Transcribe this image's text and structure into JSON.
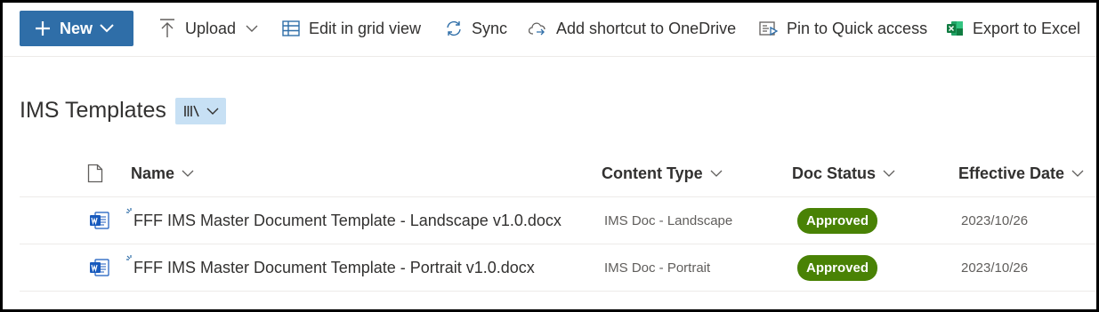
{
  "toolbar": {
    "new_label": "New",
    "upload_label": "Upload",
    "grid_label": "Edit in grid view",
    "sync_label": "Sync",
    "shortcut_label": "Add shortcut to OneDrive",
    "pin_label": "Pin to Quick access",
    "export_label": "Export to Excel"
  },
  "library": {
    "title": "IMS Templates"
  },
  "columns": {
    "name": "Name",
    "content_type": "Content Type",
    "doc_status": "Doc Status",
    "effective_date": "Effective Date"
  },
  "rows": [
    {
      "name": "FFF IMS Master Document Template - Landscape  v1.0.docx",
      "content_type": "IMS Doc - Landscape",
      "status": "Approved",
      "date": "2023/10/26"
    },
    {
      "name": "FFF IMS Master Document Template - Portrait v1.0.docx",
      "content_type": "IMS Doc - Portrait",
      "status": "Approved",
      "date": "2023/10/26"
    }
  ],
  "colors": {
    "primary": "#2f6ea8",
    "approved": "#498205",
    "view_selected": "#c7e0f4",
    "word_blue": "#185abd",
    "excel_green": "#107c41"
  },
  "icons": {
    "new": "plus-icon",
    "upload": "upload-arrow-icon",
    "grid": "grid-icon",
    "sync": "sync-icon",
    "shortcut": "cloud-link-icon",
    "pin": "pin-icon",
    "export": "excel-icon",
    "view": "library-view-icon",
    "file_header": "file-icon",
    "row_file": "word-doc-icon"
  }
}
